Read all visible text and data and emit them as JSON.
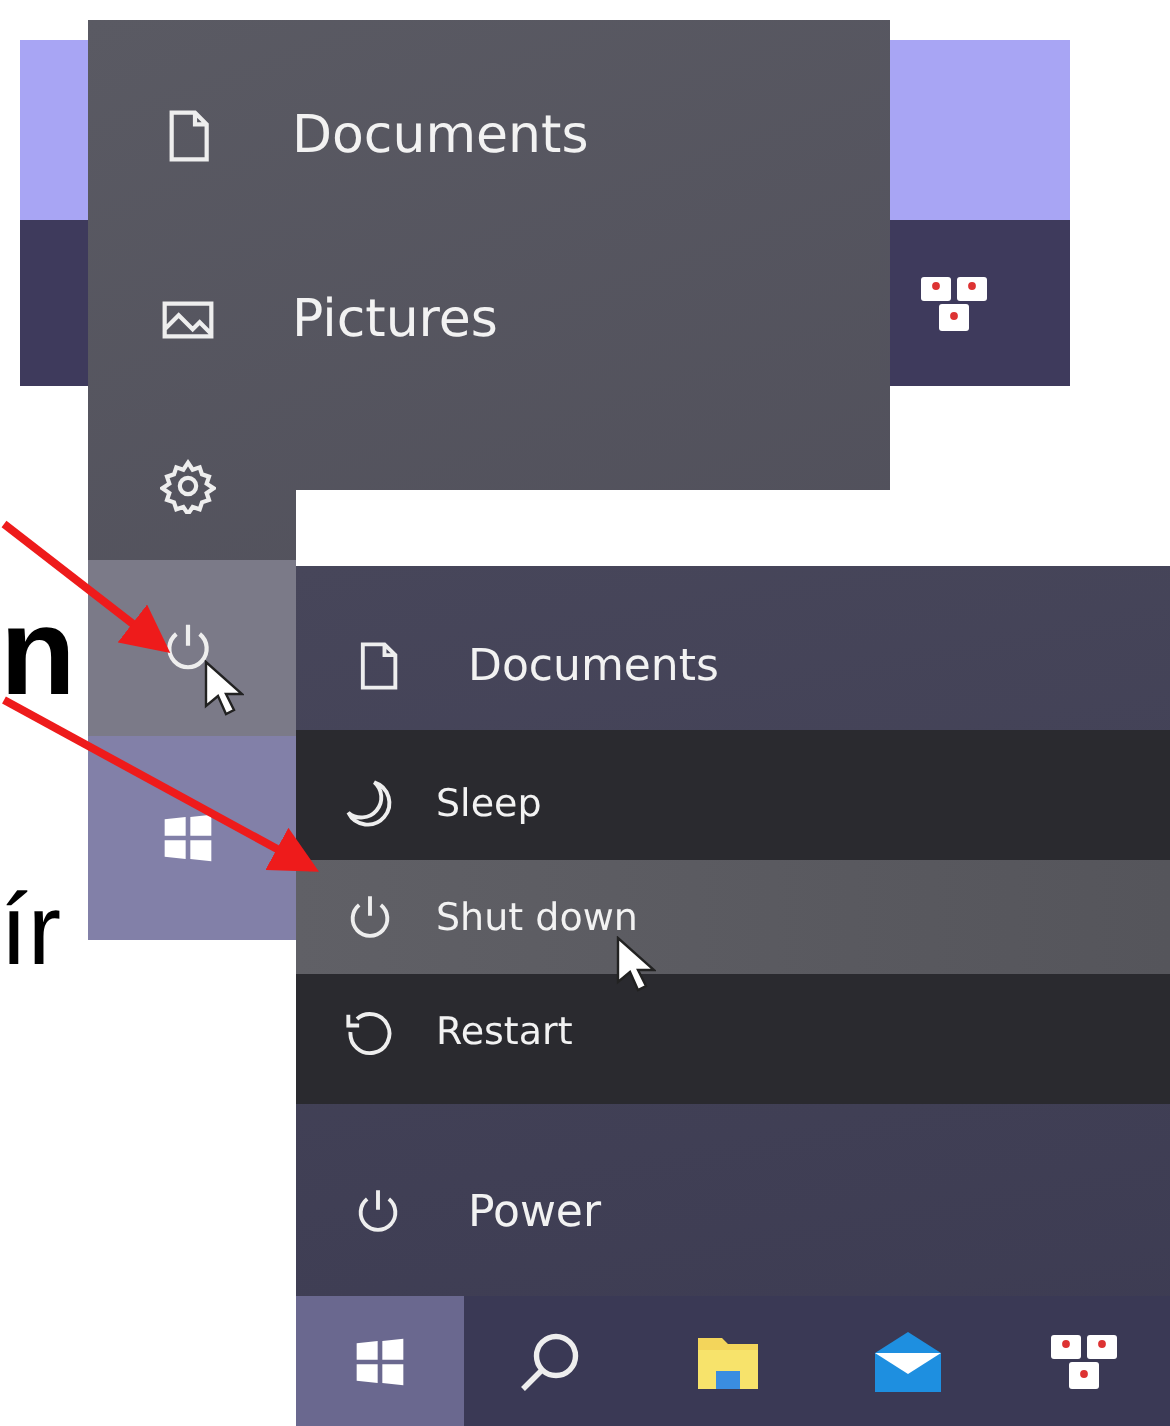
{
  "caption_fragments": [
    {
      "kind": "large",
      "text": "n"
    },
    {
      "kind": "medium",
      "text": "ír"
    }
  ],
  "left_menu": {
    "items": [
      {
        "kind": "documents",
        "label": "Documents",
        "selected": false
      },
      {
        "kind": "pictures",
        "label": "Pictures",
        "selected": false
      },
      {
        "kind": "settings",
        "selected": false
      },
      {
        "kind": "power",
        "selected": true
      },
      {
        "kind": "start",
        "selected": false
      }
    ]
  },
  "right_menu": {
    "items": [
      {
        "kind": "documents",
        "label": "Documents"
      }
    ],
    "power_menu": [
      {
        "kind": "sleep",
        "label": "Sleep",
        "selected": false
      },
      {
        "kind": "power",
        "label": "Shut down",
        "selected": true
      },
      {
        "kind": "restart",
        "label": "Restart",
        "selected": false
      }
    ],
    "footer_item": {
      "kind": "power",
      "label": "Power"
    },
    "taskbar": [
      {
        "kind": "start",
        "selected": true
      },
      {
        "kind": "search",
        "selected": false
      },
      {
        "kind": "folder",
        "selected": false
      },
      {
        "kind": "mail",
        "selected": false
      },
      {
        "kind": "tiles",
        "selected": false
      }
    ]
  }
}
